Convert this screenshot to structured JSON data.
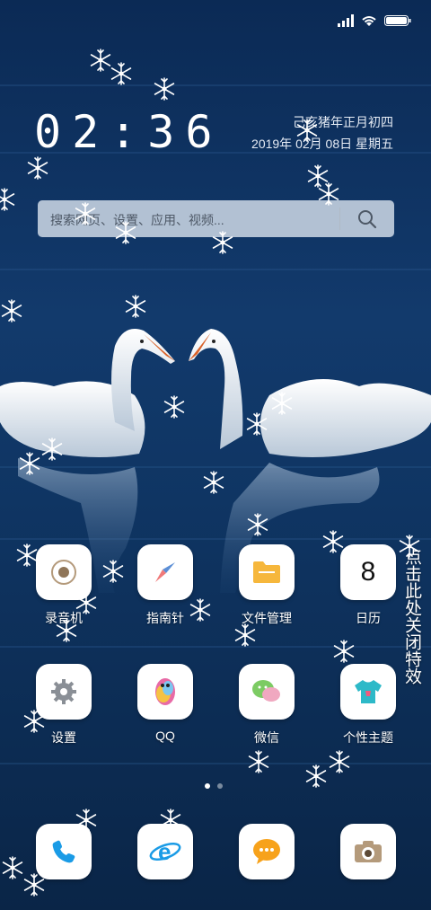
{
  "status_bar": {
    "icons": [
      "signal-icon",
      "wifi-icon",
      "battery-icon"
    ]
  },
  "clock": {
    "time": "02:36",
    "lunar_date": "己亥猪年正月初四",
    "date": "2019年 02月 08日 星期五"
  },
  "search": {
    "placeholder": "搜索网页、设置、应用、视频..."
  },
  "apps_row1": [
    {
      "label": "录音机",
      "icon": "recorder-icon"
    },
    {
      "label": "指南针",
      "icon": "compass-icon"
    },
    {
      "label": "文件管理",
      "icon": "folder-icon"
    },
    {
      "label": "日历",
      "icon": "calendar-icon",
      "icon_text": "8"
    }
  ],
  "apps_row2": [
    {
      "label": "设置",
      "icon": "gear-icon"
    },
    {
      "label": "QQ",
      "icon": "qq-penguin-icon"
    },
    {
      "label": "微信",
      "icon": "wechat-icon"
    },
    {
      "label": "个性主题",
      "icon": "theme-shirt-icon"
    }
  ],
  "dock": [
    {
      "icon": "phone-icon"
    },
    {
      "icon": "browser-icon"
    },
    {
      "icon": "messages-icon"
    },
    {
      "icon": "camera-icon"
    }
  ],
  "effect_toggle": {
    "text": "点击此处关闭特效"
  },
  "page_indicator": {
    "current": 1,
    "total": 2
  },
  "colors": {
    "wallpaper": "#0d2c57",
    "accent_blue": "#1a9be6",
    "folder_yellow": "#f6b73c",
    "messages_orange": "#f7a21b"
  }
}
